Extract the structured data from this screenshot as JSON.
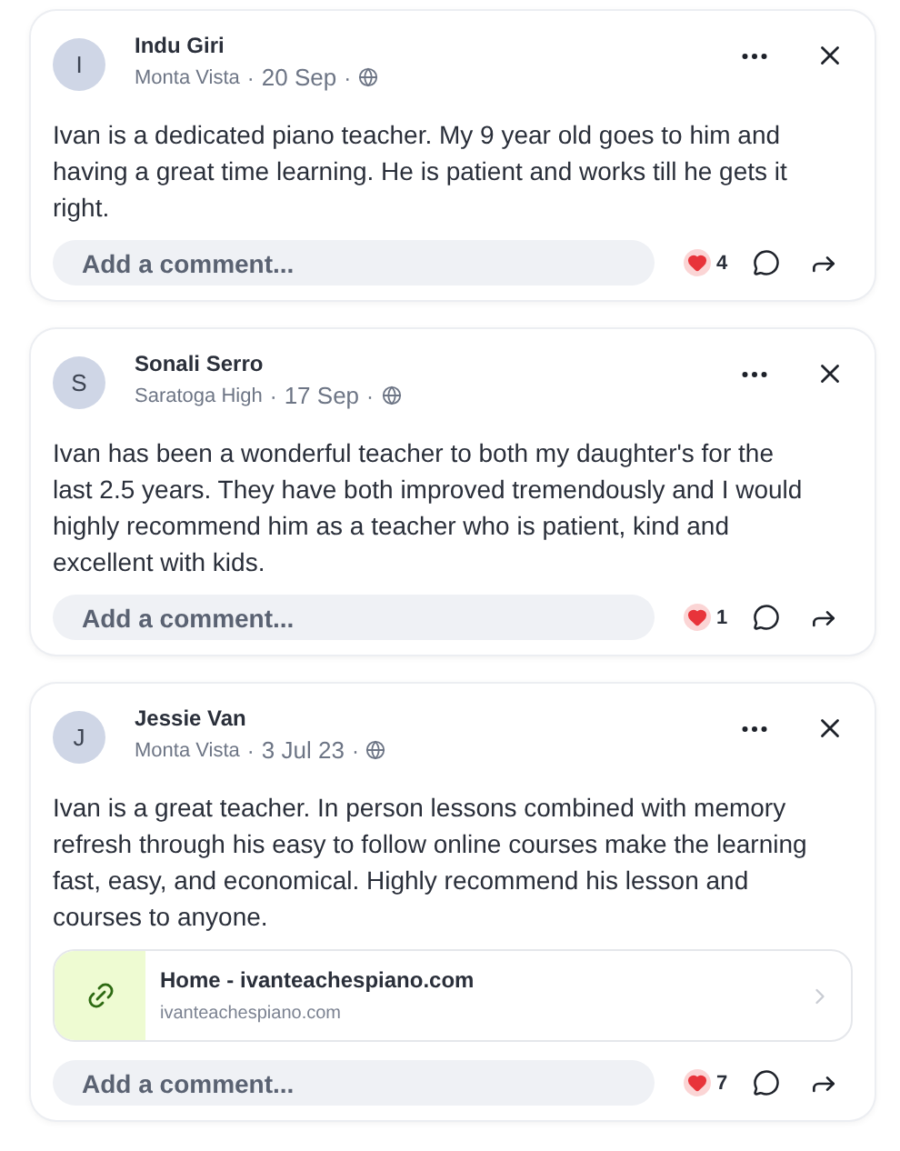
{
  "posts": [
    {
      "avatar": "I",
      "name": "Indu Giri",
      "place": "Monta Vista",
      "separators": [
        "·",
        "·"
      ],
      "date": "20 Sep",
      "text": "Ivan is a dedicated piano teacher. My 9 year old goes to him and having a great time learning. He is patient and works till he gets it right.",
      "comment": {
        "placeholder": "Add a comment..."
      },
      "reactions": "4"
    },
    {
      "avatar": "S",
      "name": "Sonali Serro",
      "place": "Saratoga High",
      "separators": [
        "·",
        "·"
      ],
      "date": "17 Sep",
      "text": "Ivan has been a wonderful teacher to both my daughter's for the last 2.5 years. They have both improved tremendously and I would highly recommend him as a teacher who is patient, kind and excellent with kids.",
      "comment": {
        "placeholder": "Add a comment..."
      },
      "reactions": "1"
    },
    {
      "avatar": "J",
      "name": "Jessie Van",
      "place": "Monta Vista",
      "separators": [
        "·",
        "·"
      ],
      "date": "3 Jul 23",
      "text": "Ivan is a great teacher. In person lessons combined with memory refresh through his easy to follow online courses make the learning fast, easy, and economical. Highly recommend his lesson and courses to anyone.",
      "link": {
        "title": "Home - ivanteachespiano.com",
        "url": "ivanteachespiano.com"
      },
      "comment": {
        "placeholder": "Add a comment..."
      },
      "reactions": "7"
    }
  ]
}
